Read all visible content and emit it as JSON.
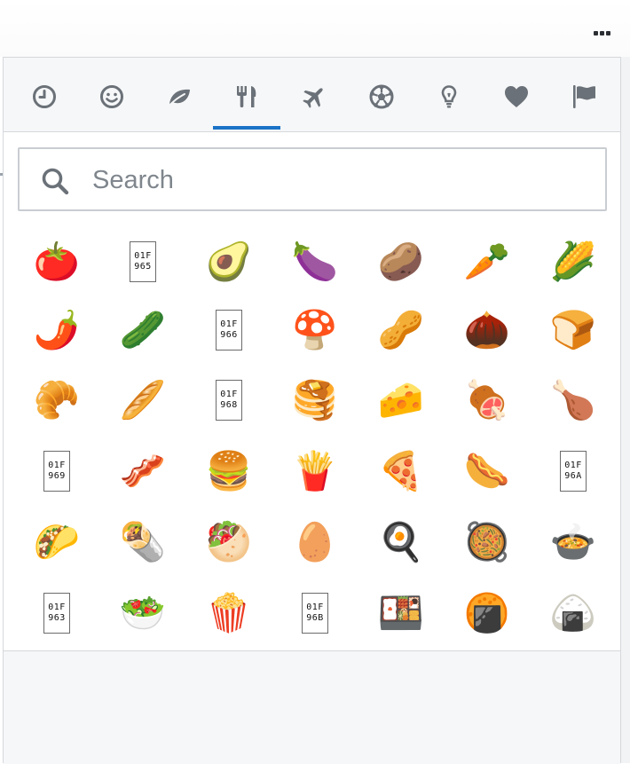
{
  "toolbar": {
    "more_icon": "more-horizontal-icon"
  },
  "tabs": [
    {
      "name": "recent",
      "icon": "clock-icon",
      "active": false
    },
    {
      "name": "smileys",
      "icon": "smiley-icon",
      "active": false
    },
    {
      "name": "nature",
      "icon": "leaf-icon",
      "active": false
    },
    {
      "name": "food",
      "icon": "fork-knife-icon",
      "active": true
    },
    {
      "name": "travel",
      "icon": "airplane-icon",
      "active": false
    },
    {
      "name": "activities",
      "icon": "soccer-ball-icon",
      "active": false
    },
    {
      "name": "objects",
      "icon": "lightbulb-icon",
      "active": false
    },
    {
      "name": "symbols",
      "icon": "heart-icon",
      "active": false
    },
    {
      "name": "flags",
      "icon": "flag-icon",
      "active": false
    }
  ],
  "search": {
    "placeholder": "Search",
    "value": ""
  },
  "colors": {
    "accent": "#1a73c7",
    "icon": "#6b7178",
    "border": "#d5d8dc",
    "tab_bg": "#f6f7f8"
  },
  "emoji_rows": [
    [
      "🍅",
      {
        "tofu": [
          "01F",
          "965"
        ]
      },
      "🥑",
      "🍆",
      "🥔",
      "🥕",
      "🌽"
    ],
    [
      "🌶️",
      "🥒",
      {
        "tofu": [
          "01F",
          "966"
        ]
      },
      "🍄",
      "🥜",
      "🌰",
      "🍞"
    ],
    [
      "🥐",
      "🥖",
      {
        "tofu": [
          "01F",
          "968"
        ]
      },
      "🥞",
      "🧀",
      "🍖",
      "🍗"
    ],
    [
      {
        "tofu": [
          "01F",
          "969"
        ]
      },
      "🥓",
      "🍔",
      "🍟",
      "🍕",
      "🌭",
      {
        "tofu": [
          "01F",
          "96A"
        ]
      }
    ],
    [
      "🌮",
      "🌯",
      "🥙",
      "🥚",
      "🍳",
      "🥘",
      "🍲"
    ],
    [
      {
        "tofu": [
          "01F",
          "963"
        ]
      },
      "🥗",
      "🍿",
      {
        "tofu": [
          "01F",
          "96B"
        ]
      },
      "🍱",
      "🍘",
      "🍙"
    ]
  ]
}
